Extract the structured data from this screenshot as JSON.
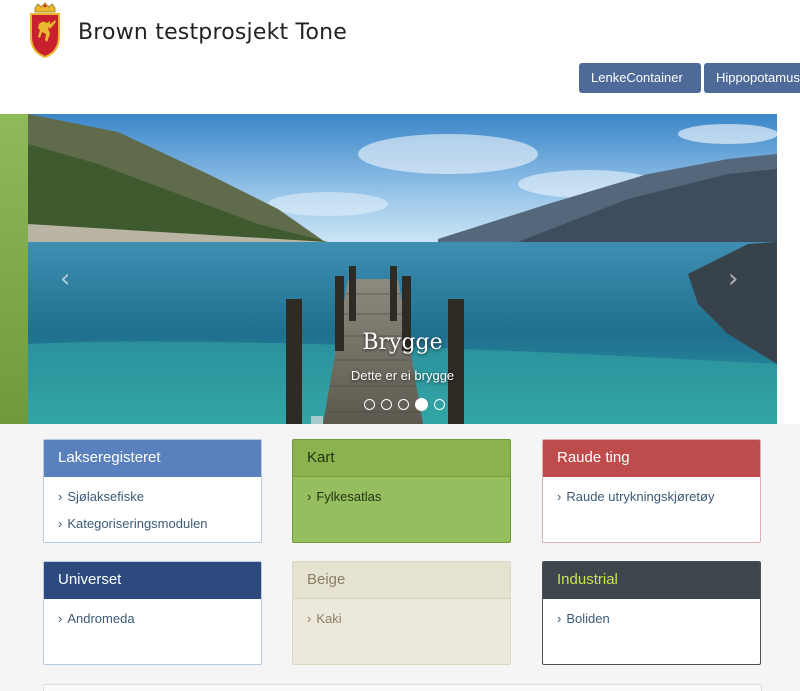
{
  "header": {
    "site_title": "Brown testprosjekt Tone",
    "nav": [
      "LenkeContainer",
      "Hippopotamus"
    ],
    "logo_icon": "norwegian-coat-of-arms-icon"
  },
  "carousel": {
    "slide_title": "Brygge",
    "slide_text": "Dette er ei brygge",
    "slide_count": 5,
    "active_slide": 4,
    "prev_icon": "chevron-left-icon",
    "next_icon": "chevron-right-icon"
  },
  "panels": [
    {
      "title": "Lakseregisteret",
      "links": [
        "Sjølaksefiske",
        "Kategoriseringsmodulen"
      ],
      "color": "#5a80bd"
    },
    {
      "title": "Kart",
      "links": [
        "Fylkesatlas"
      ],
      "color": "#8ab24f"
    },
    {
      "title": "Raude ting",
      "links": [
        "Raude utrykningskjøretøy"
      ],
      "color": "#be4c4c"
    },
    {
      "title": "Universet",
      "links": [
        "Andromeda"
      ],
      "color": "#2c4a7e"
    },
    {
      "title": "Beige",
      "links": [
        "Kaki"
      ],
      "color": "#e6e2d2"
    },
    {
      "title": "Industrial",
      "links": [
        "Boliden"
      ],
      "color": "#3e454d"
    }
  ],
  "colors": {
    "nav_button": "#4d6a99",
    "accent_green": "#8fba5a"
  }
}
